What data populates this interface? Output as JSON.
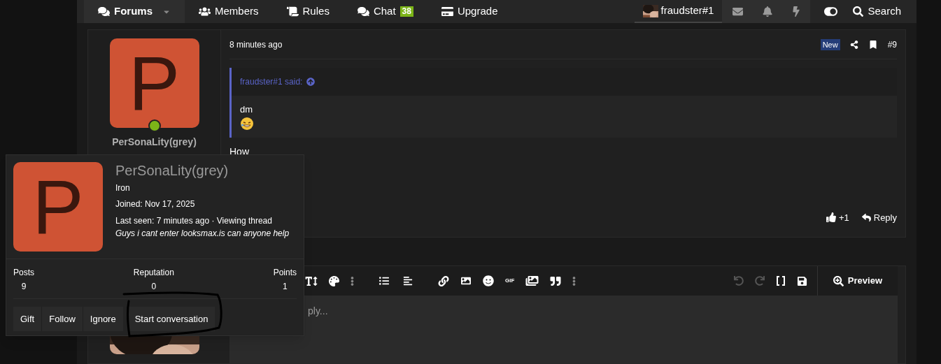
{
  "nav": {
    "items": [
      {
        "label": "Forums",
        "selected": true,
        "has_menu": true
      },
      {
        "label": "Members",
        "selected": false,
        "has_menu": false
      },
      {
        "label": "Rules",
        "selected": false,
        "has_menu": false
      },
      {
        "label": "Chat",
        "selected": false,
        "has_menu": false,
        "badge": "38"
      },
      {
        "label": "Upgrade",
        "selected": false,
        "has_menu": false
      }
    ],
    "user": {
      "name": "fraudster#1"
    },
    "search": {
      "label": "Search"
    }
  },
  "post": {
    "author": {
      "initial": "P",
      "name": "PerSonaLity(grey)",
      "online": true
    },
    "time": "8 minutes ago",
    "new_badge": "New",
    "number": "#9",
    "quote": {
      "author": "fraudster#1 said:",
      "text": "dm"
    },
    "body": "How",
    "actions": {
      "like": "+1",
      "reply": "Reply"
    }
  },
  "editor": {
    "placeholder": "ply...",
    "preview": "Preview",
    "gif": "GIF"
  },
  "popover": {
    "initial": "P",
    "name": "PerSonaLity(grey)",
    "rank": "Iron",
    "joined": "Joined: Nov 17, 2025",
    "last_seen": "Last seen: 7 minutes ago · Viewing thread",
    "status": "Guys i cant enter looksmax.is can anyone help",
    "stats": [
      {
        "label": "Posts",
        "value": "9"
      },
      {
        "label": "Reputation",
        "value": "0"
      },
      {
        "label": "Points",
        "value": "1"
      }
    ],
    "buttons": [
      "Gift",
      "Follow",
      "Ignore"
    ],
    "start_button": "Start conversation"
  }
}
